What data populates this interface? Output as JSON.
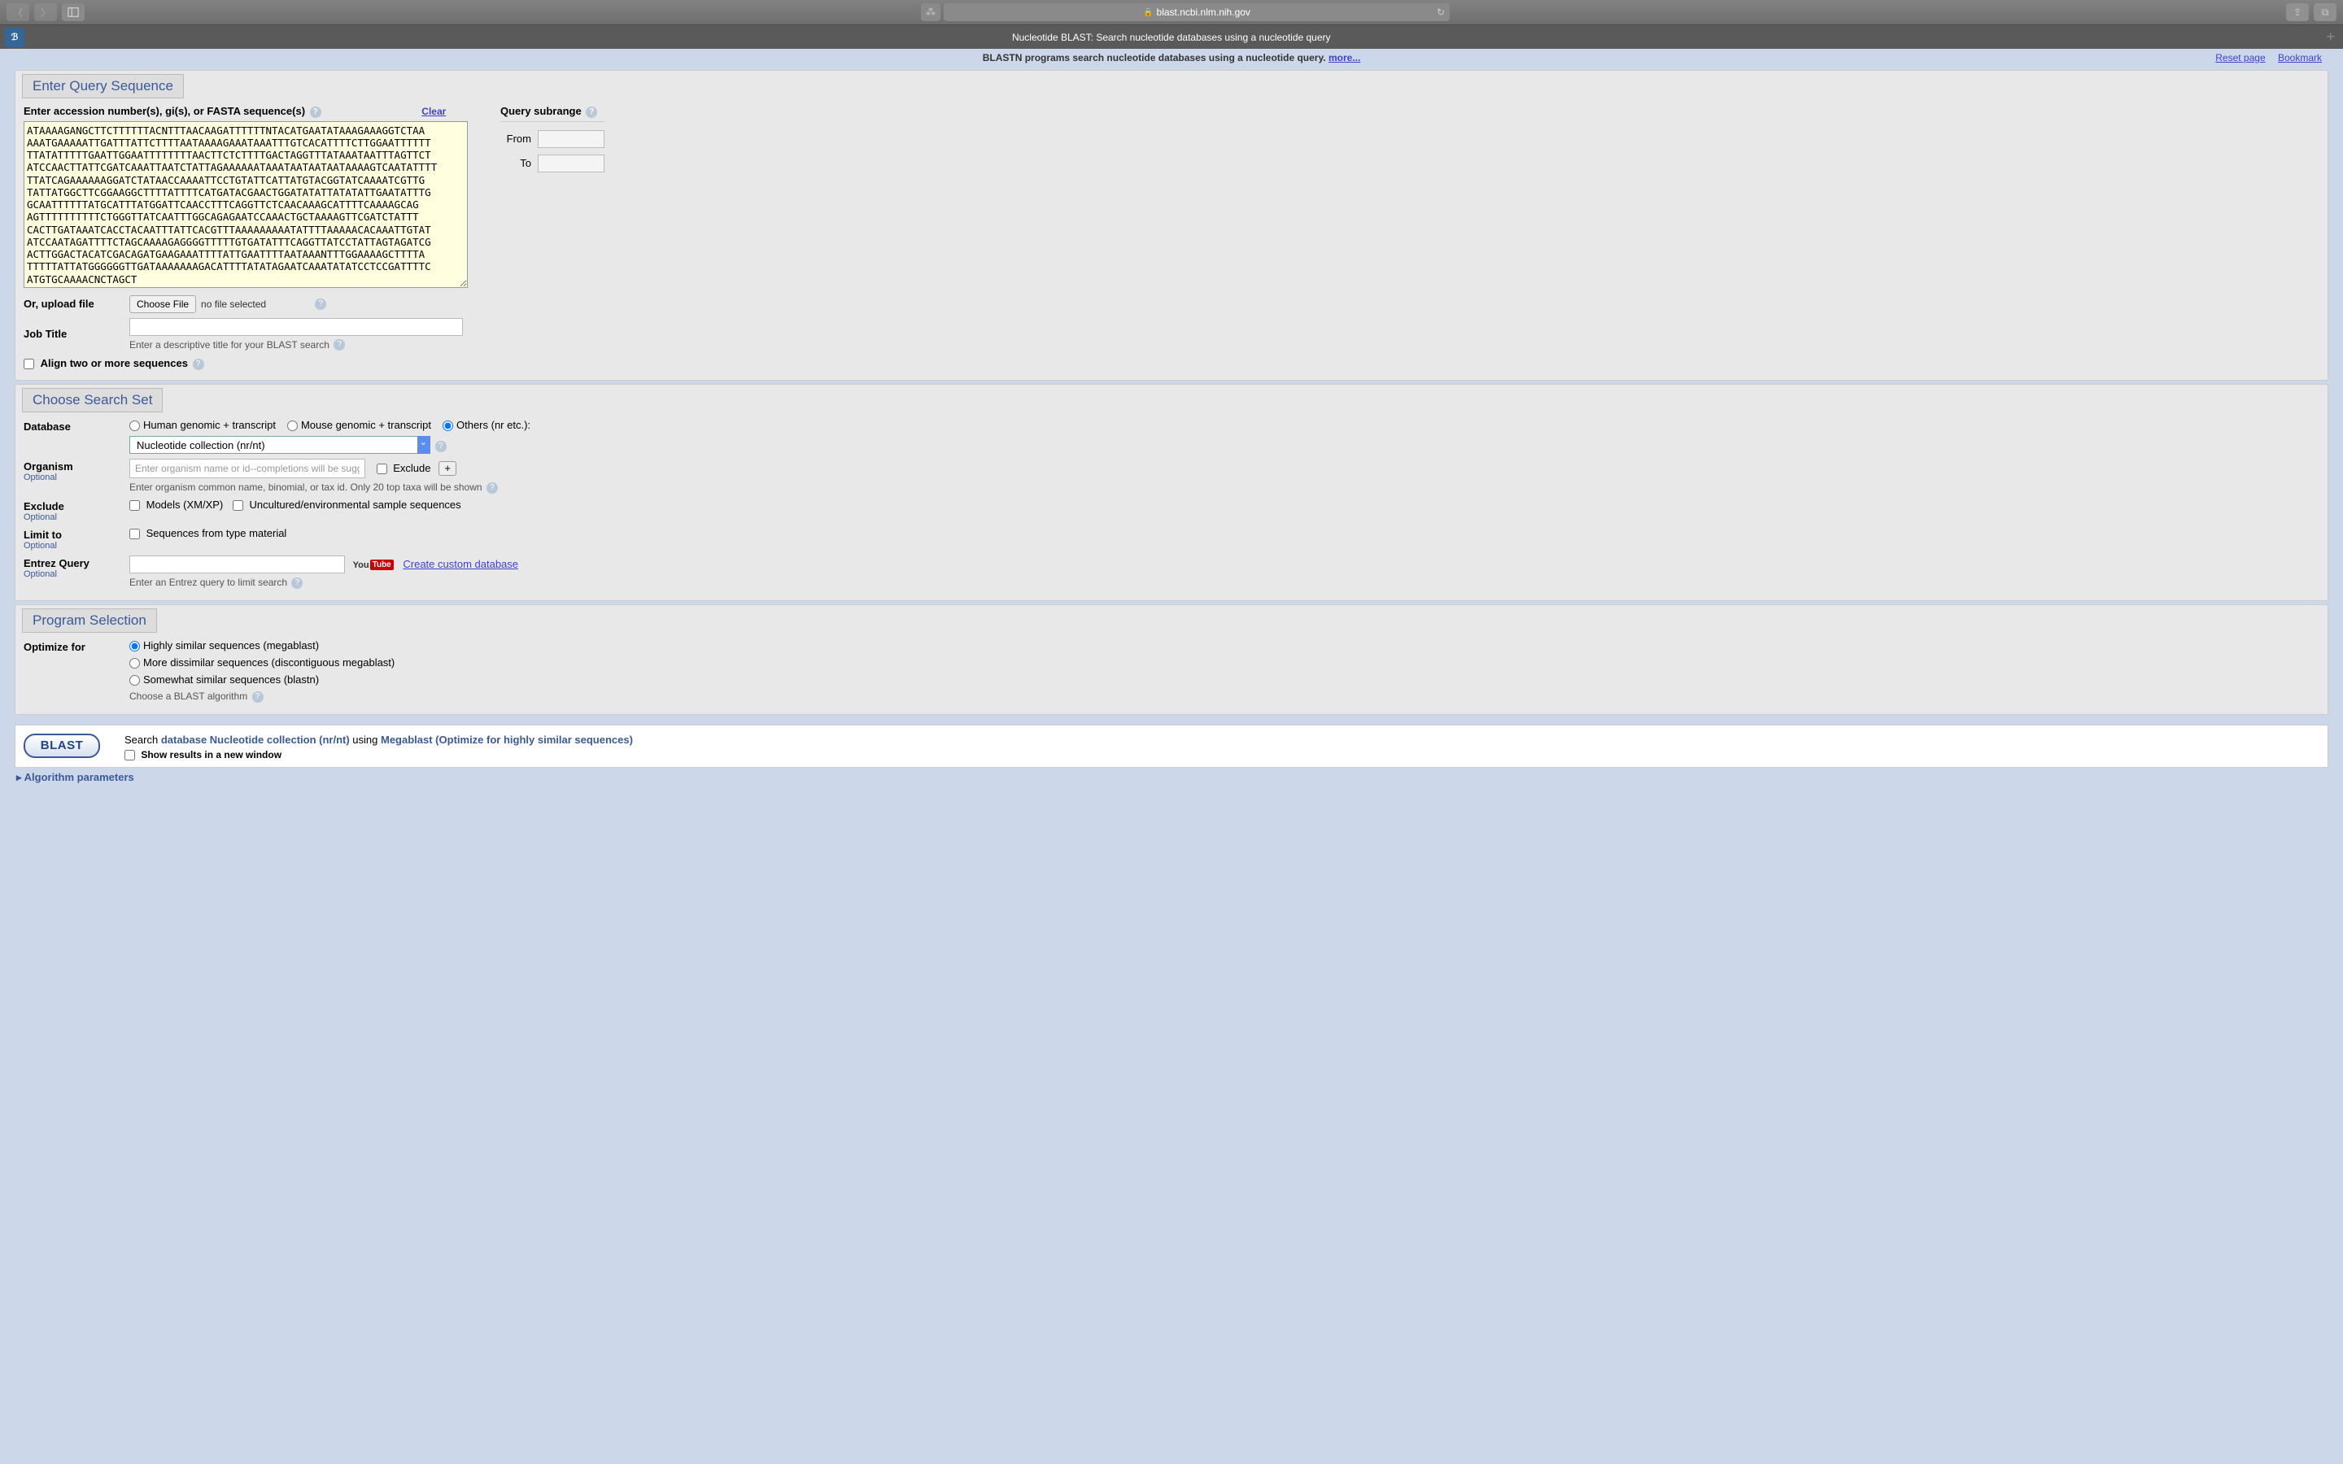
{
  "browser": {
    "url_host": "blast.ncbi.nlm.nih.gov",
    "tab_title": "Nucleotide BLAST: Search nucleotide databases using a nucleotide query"
  },
  "header": {
    "subtitle": "BLASTN programs search nucleotide databases using a nucleotide query.",
    "more": "more...",
    "reset": "Reset page",
    "bookmark": "Bookmark"
  },
  "query": {
    "section_title": "Enter Query Sequence",
    "accession_label": "Enter accession number(s), gi(s), or FASTA sequence(s)",
    "clear": "Clear",
    "sequence": "ATAAAAGANGCTTCTTTTTTACNTTTAACAAGATTTTTTNTACATGAATATAAAGAAAGGTCTAA\nAAATGAAAAATTGATTTATTCTTTTAATAAAAGAAATAAATTTGTCACATTTTCTTGGAATTTTTT\nTTATATTTTTGAATTGGAATTTTTTTTAACTTCTCTTTTGACTAGGTTTATAAATAATTTAGTTCT\nATCCAACTTATTCGATCAAATTAATCTATTAGAAAAAATAAATAATAATAATAAAAGTCAATATTTT\nTTATCAGAAAAAAGGATCTATAACCAAAATTCCTGTATTCATTATGTACGGTATCAAAATCGTTG\nTATTATGGCTTCGGAAGGCTTTTATTTTCATGATACGAACTGGATATATTATATATTGAATATTTG\nGCAATTTTTTATGCATTTATGGATTCAACCTTTCAGGTTCTCAACAAAGCATTTTCAAAAGCAG\nAGTTTTTTTTTTCTGGGTTATCAATTTGGCAGAGAATCCAAACTGCTAAAAGTTCGATCTATTT\nCACTTGATAAATCACCTACAATTTATTCACGTTTAAAAAAAAATATTTTAAAAACACAAATTGTAT\nATCCAATAGATTTTCTAGCAAAAGAGGGGTTTTTGTGATATTTCAGGTTATCCTATTAGTAGATCG\nACTTGGACTACATCGACAGATGAAGAAATTTTATTGAATTTTAATAAANTTTGGAAAAGCTTTTA\nTTTTTATTATGGGGGGTTGATAAAAAAAGACATTTTATATAGAATCAAATATATCCTCCGATTTTC\nATGTGCAAAACNCTAGCT",
    "subrange_title": "Query subrange",
    "from_label": "From",
    "to_label": "To",
    "upload_label": "Or, upload file",
    "choose_file": "Choose File",
    "no_file": "no file selected",
    "job_title_label": "Job Title",
    "job_title_hint": "Enter a descriptive title for your BLAST search",
    "align_label": "Align two or more sequences"
  },
  "search_set": {
    "section_title": "Choose Search Set",
    "database_label": "Database",
    "radio_human": "Human genomic + transcript",
    "radio_mouse": "Mouse genomic + transcript",
    "radio_others": "Others (nr etc.):",
    "db_selected": "Nucleotide collection (nr/nt)",
    "organism_label": "Organism",
    "organism_placeholder": "Enter organism name or id--completions will be suggested",
    "exclude_label": "Exclude",
    "organism_hint": "Enter organism common name, binomial, or tax id. Only 20 top taxa will be shown",
    "exclude_row_label": "Exclude",
    "exclude_models": "Models (XM/XP)",
    "exclude_uncultured": "Uncultured/environmental sample sequences",
    "limit_label": "Limit to",
    "limit_type": "Sequences from type material",
    "entrez_label": "Entrez Query",
    "entrez_hint": "Enter an Entrez query to limit search",
    "create_custom": "Create custom database",
    "optional": "Optional"
  },
  "program": {
    "section_title": "Program Selection",
    "optimize_label": "Optimize for",
    "opt_mega": "Highly similar sequences (megablast)",
    "opt_disc": "More dissimilar sequences (discontiguous megablast)",
    "opt_blastn": "Somewhat similar sequences (blastn)",
    "hint": "Choose a BLAST algorithm"
  },
  "submit": {
    "button": "BLAST",
    "prefix": "Search ",
    "db_link": "database Nucleotide collection (nr/nt)",
    "using": " using ",
    "prog_link": "Megablast (Optimize for highly similar sequences)",
    "new_window": "Show results in a new window",
    "algo_params": "Algorithm parameters"
  }
}
